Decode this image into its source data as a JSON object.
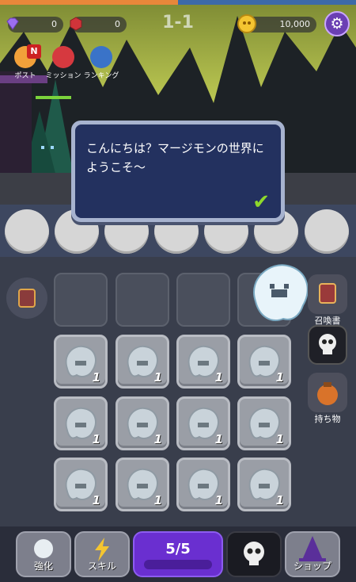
{
  "header": {
    "gems": "0",
    "rubies": "0",
    "stage": "1-1",
    "coins": "10,000",
    "settings_icon": "gear-icon"
  },
  "menu": {
    "post_label": "ポスト",
    "post_badge": "N",
    "mission_label": "ミッション",
    "ranking_label": "ランキング"
  },
  "dialog": {
    "text": "こんにちは？マージモンの世界にようこそ〜",
    "confirm_icon": "check-icon"
  },
  "board": {
    "empty_cells": 3,
    "ghost_count": "1",
    "ghost_cells": 12
  },
  "side": {
    "summon_label": "召喚書",
    "items_label": "持ち物"
  },
  "bottom": {
    "upgrade_label": "強化",
    "skill_label": "スキル",
    "progress": "5/5",
    "shop_label": "ショップ"
  },
  "colors": {
    "accent_purple": "#6a2fd0",
    "check_green": "#8ed82b",
    "dialog_bg": "#23315f"
  }
}
